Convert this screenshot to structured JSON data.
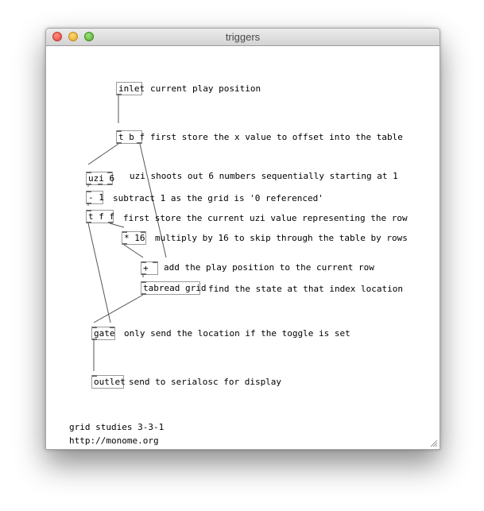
{
  "window": {
    "title": "triggers",
    "buttons": {
      "close": "close-icon",
      "minimize": "minimize-icon",
      "zoom": "zoom-icon"
    }
  },
  "objects": {
    "inlet": "inlet",
    "trigger_bf": "t b f",
    "uzi": "uzi 6",
    "minus": "- 1",
    "trigger_ff": "t f f",
    "mult": "* 16",
    "plus": "+",
    "tabread": "tabread grid",
    "gate": "gate",
    "outlet": "outlet"
  },
  "comments": {
    "inlet": "current play position",
    "trigger_bf": "first store the x value to offset into the table",
    "uzi": "uzi shoots out 6 numbers sequentially starting at 1",
    "minus": "subtract 1 as the grid is '0 referenced'",
    "trigger_ff": "first store the current uzi value representing the row",
    "mult": "multiply by 16 to skip through the table by rows",
    "plus": "add the play position to the current row",
    "tabread": "find the state at that index location",
    "gate": "only send the location if the toggle is set",
    "outlet": "send to serialosc for display",
    "footer_title": "grid studies 3-3-1",
    "footer_url": "http://monome.org"
  }
}
